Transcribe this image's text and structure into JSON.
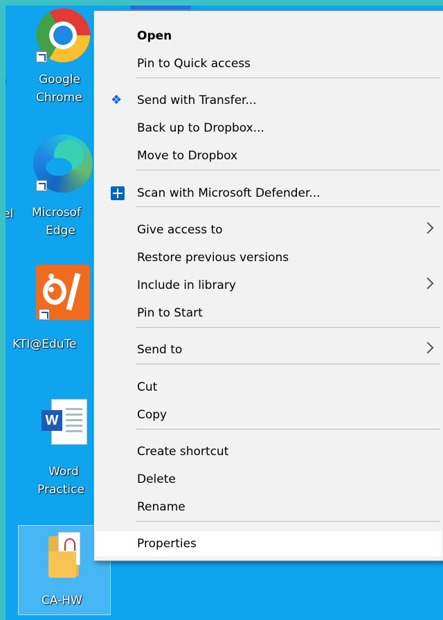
{
  "desktop": {
    "icons": [
      {
        "name": "chrome",
        "label_line1": "Google",
        "label_line2": "Chrome"
      },
      {
        "name": "edge",
        "label_line1": "Microsof",
        "label_line2": "Edge",
        "left_fragment": "el"
      },
      {
        "name": "kti",
        "label_line1": "KTI@EduTe"
      },
      {
        "name": "word",
        "label_line1": "Word",
        "label_line2": "Practice"
      },
      {
        "name": "folder",
        "label_line1": "CA-HW"
      }
    ]
  },
  "context_menu": {
    "items": [
      {
        "label": "Open",
        "bold": true
      },
      {
        "label": "Pin to Quick access"
      },
      {
        "label": "Send with Transfer...",
        "icon": "dropbox-icon"
      },
      {
        "label": "Back up to Dropbox..."
      },
      {
        "label": "Move to Dropbox"
      },
      {
        "label": "Scan with Microsoft Defender...",
        "icon": "defender-icon"
      },
      {
        "label": "Give access to",
        "submenu": true
      },
      {
        "label": "Restore previous versions"
      },
      {
        "label": "Include in library",
        "submenu": true
      },
      {
        "label": "Pin to Start"
      },
      {
        "label": "Send to",
        "submenu": true
      },
      {
        "label": "Cut"
      },
      {
        "label": "Copy"
      },
      {
        "label": "Create shortcut"
      },
      {
        "label": "Delete"
      },
      {
        "label": "Rename"
      },
      {
        "label": "Properties",
        "highlighted": true
      }
    ]
  },
  "colors": {
    "desktop_bg": "#0ea4ee",
    "outer_border": "#3dc1c4",
    "menu_bg": "#f2f2f2",
    "menu_highlight": "#ffffff"
  }
}
